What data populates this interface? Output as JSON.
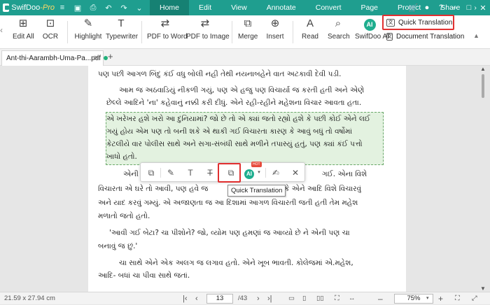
{
  "app": {
    "name": "SwifDoo",
    "edition": "-Pro"
  },
  "menu": [
    "Home",
    "Edit",
    "View",
    "Annotate",
    "Convert",
    "Page",
    "Protect",
    "Share"
  ],
  "menu_more": "›",
  "ribbon": {
    "edit_all": "Edit All",
    "ocr": "OCR",
    "highlight": "Highlight",
    "typewriter": "Typewriter",
    "pdf_to_word": "PDF to Word",
    "pdf_to_image": "PDF to Image",
    "merge": "Merge",
    "insert": "Insert",
    "read": "Read",
    "search": "Search",
    "swifdoo_ai": "SwifDoo AI",
    "ai_badge": "AI",
    "quick_translation": "Quick Translation",
    "document_translation": "Document Translation"
  },
  "tab": {
    "filename": "Ant-thi-Aarambh-Uma-Pa...pdf",
    "new_tab": "+"
  },
  "document": {
    "lines": [
      "પણ પછી આગળ બિંદુ કંઈ વધુ બોલી નહી તેથી નયનાબહેને વાત અટકાવી દેવી પડી.",
      "આમ જ અઠવાડિયું નીકળી ગયું, પણ એ હજુ પણ વિચાર્યા જ કરતી હતી અને એણે",
      "છેલ્લે આદિને 'ના' કહેવાનું નક્કી કરી દીધું. એને રહી-રહીને મહેશના વિચાર આવતા હતા.",
      "એ ખરેખર હશે ખરો આ દુનિયામાં? જો છે તો એ ક્યાં જતો રહ્યો હશે કે પછી કોઈ એને લઈ",
      "ગયું હોય એમ પણ તો બની શકે એ થાકી ગઈ વિચારતા કારણ કે આવું બધું તો વર્ષોમાં",
      "કેટલીયે વાર પોલીસ સાથે અને સગા-સંબંધી સાથે મળીને તપાસ્યું હતું, પણ ક્યાં કંઈ પત્તો",
      "ખાધો હતો.",
      "એની",
      "વિચારતા એ ઘરે તો આવી, પણ હવે જ",
      "અને યાદ કરવું ગમ્યું. એ અજાણતા જ આ દિશામાં આગળ વિચારતી જતી હતી તેમ મહેશ",
      "મળાતો જતો હતો.",
      "'આવી ગઈ બેટા? ચા પીશોને? જો, વ્યોમ પણ હમણાં જ આવ્યો છે ને એની પણ ચા",
      "બનાવું જ છું.'",
      "ચા સાથે એને એક અલગ જ લગાવ હતો. એને ખૂબ ભાવતી. કોલેજમાં એ.મહેશ,",
      "આદિ- બધાં ચા પીવા સાથે જતાં."
    ],
    "fragment_right_a": "ગઈ. એના વિશે",
    "fragment_right_b": "કે એને આદિ વિશે વિચારવું"
  },
  "float_toolbar": {
    "hot_badge": "HOT",
    "tooltip": "Quick Translation"
  },
  "status": {
    "page_size": "21.59 x 27.94 cm",
    "current_page": "13",
    "total_pages": "/43",
    "zoom": "75%"
  }
}
